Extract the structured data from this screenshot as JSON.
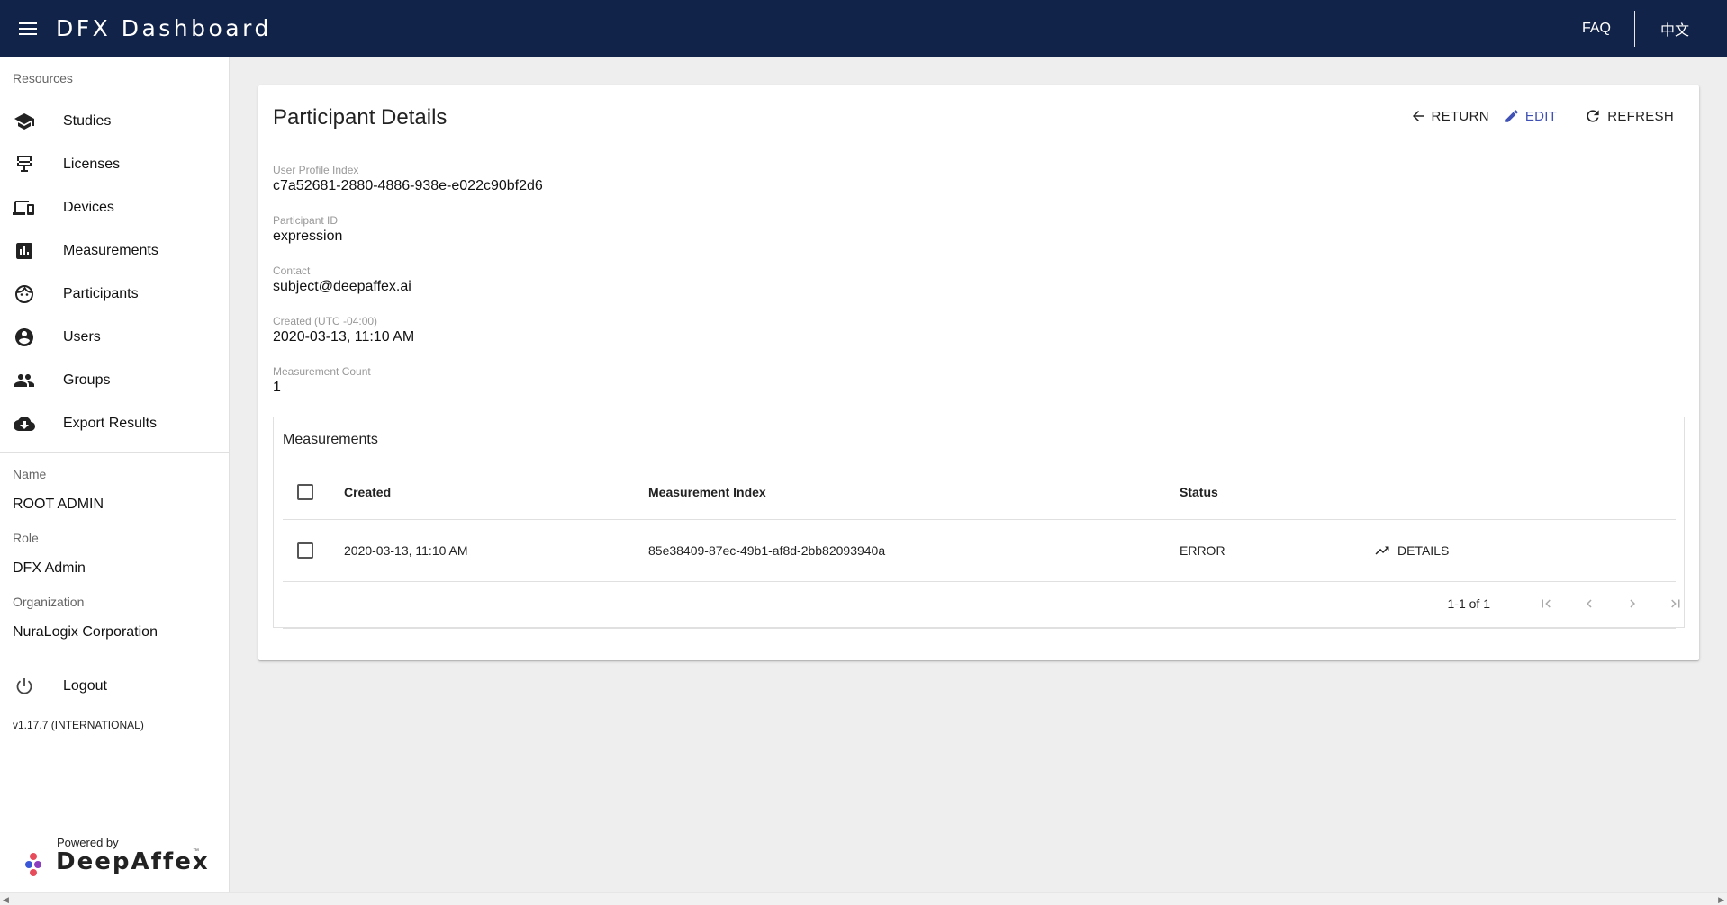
{
  "appbar": {
    "title": "DFX Dashboard",
    "faq_label": "FAQ",
    "language_label": "中文",
    "bg_color": "#122349"
  },
  "sidebar": {
    "resources_header": "Resources",
    "items": [
      {
        "label": "Studies",
        "icon": "school-icon"
      },
      {
        "label": "Licenses",
        "icon": "license-icon"
      },
      {
        "label": "Devices",
        "icon": "devices-icon"
      },
      {
        "label": "Measurements",
        "icon": "chart-icon"
      },
      {
        "label": "Participants",
        "icon": "face-icon"
      },
      {
        "label": "Users",
        "icon": "account-icon"
      },
      {
        "label": "Groups",
        "icon": "group-icon"
      },
      {
        "label": "Export Results",
        "icon": "cloud-download-icon"
      }
    ],
    "name_label": "Name",
    "name_value": "ROOT ADMIN",
    "role_label": "Role",
    "role_value": "DFX Admin",
    "org_label": "Organization",
    "org_value": "NuraLogix Corporation",
    "logout_label": "Logout",
    "version": "v1.17.7 (INTERNATIONAL)",
    "powered_by": "Powered by",
    "brand": "DeepAffex",
    "trademark": "™"
  },
  "main": {
    "title": "Participant Details",
    "actions": {
      "return_label": "RETURN",
      "edit_label": "EDIT",
      "refresh_label": "REFRESH"
    },
    "fields": {
      "profile_index_label": "User Profile Index",
      "profile_index_value": "c7a52681-2880-4886-938e-e022c90bf2d6",
      "participant_id_label": "Participant ID",
      "participant_id_value": "expression",
      "contact_label": "Contact",
      "contact_value": "subject@deepaffex.ai",
      "created_label": "Created (UTC -04:00)",
      "created_value": "2020-03-13, 11:10 AM",
      "count_label": "Measurement Count",
      "count_value": "1"
    },
    "measurements": {
      "title": "Measurements",
      "columns": [
        "Created",
        "Measurement Index",
        "Status"
      ],
      "rows": [
        {
          "created": "2020-03-13, 11:10 AM",
          "index": "85e38409-87ec-49b1-af8d-2bb82093940a",
          "status": "ERROR",
          "action": "DETAILS"
        }
      ],
      "pagination": "1-1 of 1"
    }
  }
}
